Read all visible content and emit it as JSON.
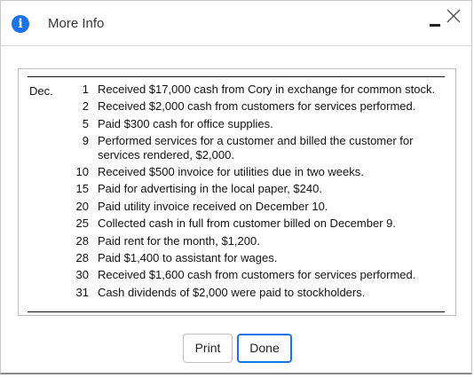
{
  "dialog": {
    "title": "More Info",
    "info_icon_glyph": "i",
    "accent_color": "#1a73e8"
  },
  "content": {
    "month": "Dec.",
    "entries": [
      {
        "day": "1",
        "text": "Received $17,000 cash from Cory in exchange for common stock."
      },
      {
        "day": "2",
        "text": "Received $2,000 cash from customers for services performed."
      },
      {
        "day": "5",
        "text": "Paid $300 cash for office supplies."
      },
      {
        "day": "9",
        "text": "Performed services for a customer and billed the customer for services rendered, $2,000."
      },
      {
        "day": "10",
        "text": "Received $500 invoice for utilities due in two weeks."
      },
      {
        "day": "15",
        "text": "Paid for advertising in the local paper, $240."
      },
      {
        "day": "20",
        "text": "Paid utility invoice received on December 10."
      },
      {
        "day": "25",
        "text": "Collected cash in full from customer billed on December 9."
      },
      {
        "day": "28",
        "text": "Paid rent for the month, $1,200."
      },
      {
        "day": "28",
        "text": "Paid $1,400 to assistant for wages."
      },
      {
        "day": "30",
        "text": "Received $1,600 cash from customers for services performed."
      },
      {
        "day": "31",
        "text": "Cash dividends of $2,000 were paid to stockholders."
      }
    ]
  },
  "buttons": {
    "print_label": "Print",
    "done_label": "Done"
  }
}
